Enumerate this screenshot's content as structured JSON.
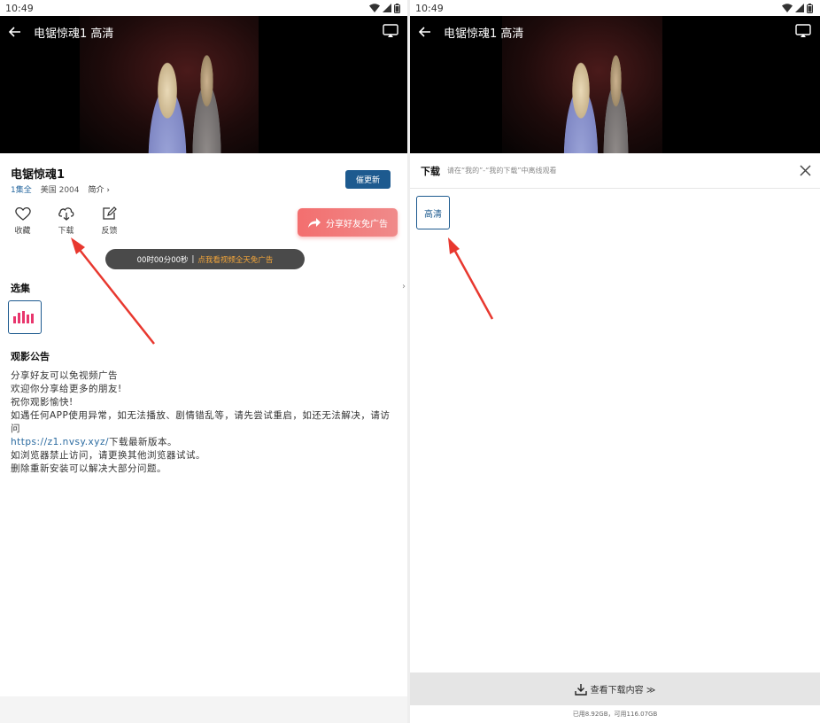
{
  "status": {
    "time": "10:49"
  },
  "video": {
    "title": "电锯惊魂1 高清"
  },
  "details": {
    "movie_title": "电锯惊魂1",
    "episodes_label": "1集全",
    "region_year": "美国 2004",
    "intro_label": "简介 ›",
    "update_button": "催更新",
    "actions": [
      {
        "label": "收藏",
        "icon": "heart-icon"
      },
      {
        "label": "下载",
        "icon": "download-cloud-icon"
      },
      {
        "label": "反馈",
        "icon": "feedback-edit-icon"
      }
    ],
    "share_button": "分享好友免广告",
    "timer": {
      "time": "00时00分00秒",
      "separator": "|",
      "promo": "点我看视频全天免广告"
    },
    "episodes_section": "选集",
    "notice_title": "观影公告",
    "notice_lines": [
      "分享好友可以免视频广告",
      "欢迎你分享给更多的朋友!",
      "祝你观影愉快!",
      "如遇任何APP使用异常，如无法播放、剧情错乱等，请先尝试重启，如还无法解决，请访问"
    ],
    "notice_link": "https://z1.nvsy.xyz/",
    "notice_link_suffix": "下载最新版本。",
    "notice_lines_after": [
      "如浏览器禁止访问，请更换其他浏览器试试。",
      "删除重新安装可以解决大部分问题。"
    ]
  },
  "download_panel": {
    "title": "下载",
    "hint": "请在“我的”-“我的下载”中离线观看",
    "quality_option": "高清",
    "view_downloads": "查看下载内容 ≫",
    "storage": "已用8.92GB，可用116.07GB"
  },
  "colors": {
    "accent": "#1d5a8f",
    "share_red": "#f36f6f",
    "promo_orange": "#f5a73a",
    "annotation_arrow": "#e8382f",
    "episode_bars": "#e8366d"
  }
}
